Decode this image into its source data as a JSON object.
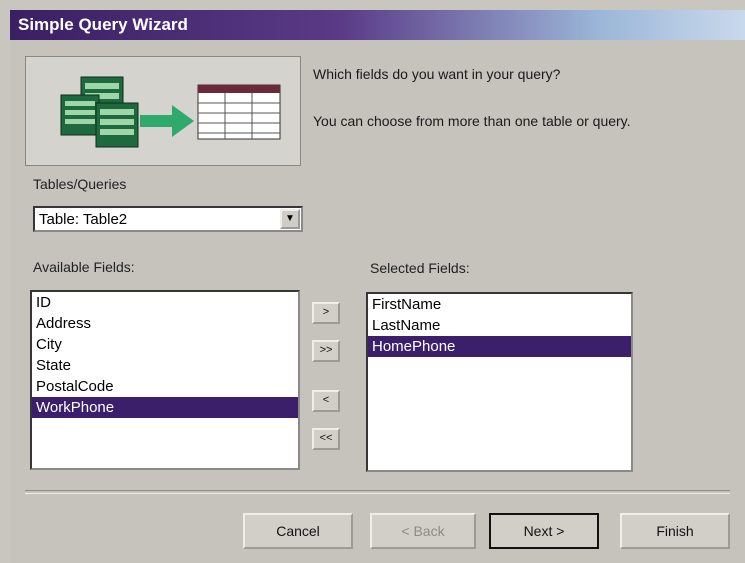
{
  "window": {
    "title": "Simple Query Wizard"
  },
  "instructions": {
    "line1": "Which fields do you want in your query?",
    "line2": "You can choose from more than one table or query."
  },
  "tables_queries": {
    "label": "Tables/Queries",
    "selected": "Table: Table2"
  },
  "available_fields": {
    "label": "Available Fields:",
    "items": [
      "ID",
      "Address",
      "City",
      "State",
      "PostalCode",
      "WorkPhone"
    ],
    "selected": "WorkPhone"
  },
  "selected_fields": {
    "label": "Selected Fields:",
    "items": [
      "FirstName",
      "LastName",
      "HomePhone"
    ],
    "selected": "HomePhone"
  },
  "move_buttons": {
    "add_one": ">",
    "add_all": ">>",
    "remove_one": "<",
    "remove_all": "<<"
  },
  "footer": {
    "cancel": "Cancel",
    "back": "< Back",
    "next": "Next >",
    "finish": "Finish"
  },
  "colors": {
    "title_start": "#3a1f63",
    "selection": "#3b1f6b",
    "face": "#c6c3bd"
  },
  "icons": [
    "tables-illustration-icon",
    "arrow-right-icon",
    "query-grid-icon",
    "dropdown-arrow-icon"
  ]
}
